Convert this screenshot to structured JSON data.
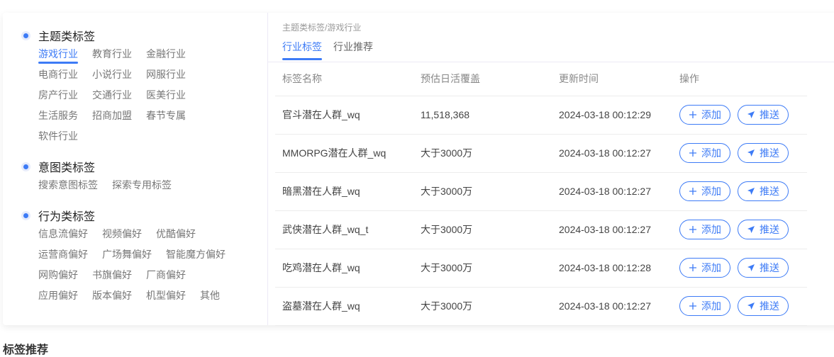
{
  "groups": [
    {
      "title": "主题类标签",
      "tags": [
        "游戏行业",
        "教育行业",
        "金融行业",
        "电商行业",
        "小说行业",
        "网服行业",
        "房产行业",
        "交通行业",
        "医美行业",
        "生活服务",
        "招商加盟",
        "春节专属",
        "软件行业"
      ]
    },
    {
      "title": "意图类标签",
      "tags": [
        "搜索意图标签",
        "探索专用标签"
      ]
    },
    {
      "title": "行为类标签",
      "tags": [
        "信息流偏好",
        "视频偏好",
        "优酷偏好",
        "运营商偏好",
        "广场舞偏好",
        "智能魔方偏好",
        "网购偏好",
        "书旗偏好",
        "厂商偏好",
        "应用偏好",
        "版本偏好",
        "机型偏好",
        "其他"
      ]
    }
  ],
  "breadcrumb": "主题类标签/游戏行业",
  "tabs": [
    "行业标签",
    "行业推荐"
  ],
  "table": {
    "headers": [
      "标签名称",
      "预估日活覆盖",
      "更新时间",
      "操作"
    ],
    "rows": [
      [
        "官斗潜在人群_wq",
        "11,518,368",
        "2024-03-18 00:12:29"
      ],
      [
        "MMORPG潜在人群_wq",
        "大于3000万",
        "2024-03-18 00:12:27"
      ],
      [
        "暗黑潜在人群_wq",
        "大于3000万",
        "2024-03-18 00:12:27"
      ],
      [
        "武侠潜在人群_wq_t",
        "大于3000万",
        "2024-03-18 00:12:27"
      ],
      [
        "吃鸡潜在人群_wq",
        "大于3000万",
        "2024-03-18 00:12:28"
      ],
      [
        "盗墓潜在人群_wq",
        "大于3000万",
        "2024-03-18 00:12:27"
      ]
    ],
    "add_label": "添加",
    "push_label": "推送"
  },
  "bottom_title": "标签推荐",
  "accent": "#3d7bf6"
}
